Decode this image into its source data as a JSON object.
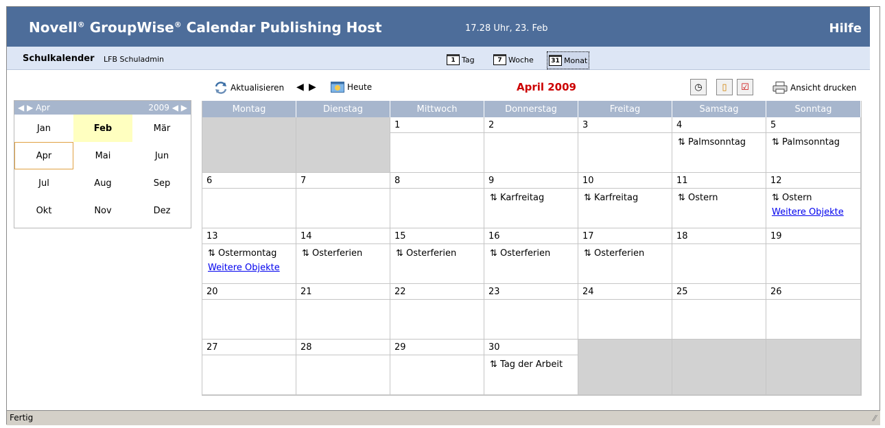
{
  "header": {
    "title_parts": [
      "Novell",
      "®",
      " GroupWise",
      "®",
      " Calendar Publishing Host"
    ],
    "datetime": "17.28 Uhr, 23. Feb",
    "help": "Hilfe"
  },
  "subbar": {
    "calendar_name": "Schulkalender",
    "owner": "LFB Schuladmin",
    "views": [
      {
        "icon": "1",
        "label": "Tag"
      },
      {
        "icon": "7",
        "label": "Woche"
      },
      {
        "icon": "31",
        "label": "Monat",
        "active": true
      }
    ]
  },
  "mini": {
    "month": "Apr",
    "year": "2009",
    "months": [
      "Jan",
      "Feb",
      "Mär",
      "Apr",
      "Mai",
      "Jun",
      "Jul",
      "Aug",
      "Sep",
      "Okt",
      "Nov",
      "Dez"
    ],
    "current": "Feb",
    "selected": "Apr"
  },
  "toolbar": {
    "refresh": "Aktualisieren",
    "today": "Heute",
    "month_title": "April 2009",
    "print": "Ansicht drucken"
  },
  "calendar": {
    "day_names": [
      "Montag",
      "Dienstag",
      "Mittwoch",
      "Donnerstag",
      "Freitag",
      "Samstag",
      "Sonntag"
    ],
    "weeks": [
      [
        {
          "empty": true
        },
        {
          "empty": true
        },
        {
          "day": "1"
        },
        {
          "day": "2"
        },
        {
          "day": "3"
        },
        {
          "day": "4",
          "events": [
            "Palmsonntag"
          ]
        },
        {
          "day": "5",
          "events": [
            "Palmsonntag"
          ]
        }
      ],
      [
        {
          "day": "6"
        },
        {
          "day": "7"
        },
        {
          "day": "8"
        },
        {
          "day": "9",
          "events": [
            "Karfreitag"
          ]
        },
        {
          "day": "10",
          "events": [
            "Karfreitag"
          ]
        },
        {
          "day": "11",
          "events": [
            "Ostern"
          ]
        },
        {
          "day": "12",
          "events": [
            "Ostern"
          ],
          "more": "Weitere Objekte"
        }
      ],
      [
        {
          "day": "13",
          "events": [
            "Ostermontag"
          ],
          "more": "Weitere Objekte"
        },
        {
          "day": "14",
          "events": [
            "Osterferien"
          ]
        },
        {
          "day": "15",
          "events": [
            "Osterferien"
          ]
        },
        {
          "day": "16",
          "events": [
            "Osterferien"
          ]
        },
        {
          "day": "17",
          "events": [
            "Osterferien"
          ]
        },
        {
          "day": "18"
        },
        {
          "day": "19"
        }
      ],
      [
        {
          "day": "20"
        },
        {
          "day": "21"
        },
        {
          "day": "22"
        },
        {
          "day": "23"
        },
        {
          "day": "24"
        },
        {
          "day": "25"
        },
        {
          "day": "26"
        }
      ],
      [
        {
          "day": "27"
        },
        {
          "day": "28"
        },
        {
          "day": "29"
        },
        {
          "day": "30",
          "events": [
            "Tag der Arbeit"
          ]
        },
        {
          "empty": true
        },
        {
          "empty": true
        },
        {
          "empty": true
        }
      ]
    ]
  },
  "status": {
    "text": "Fertig"
  }
}
